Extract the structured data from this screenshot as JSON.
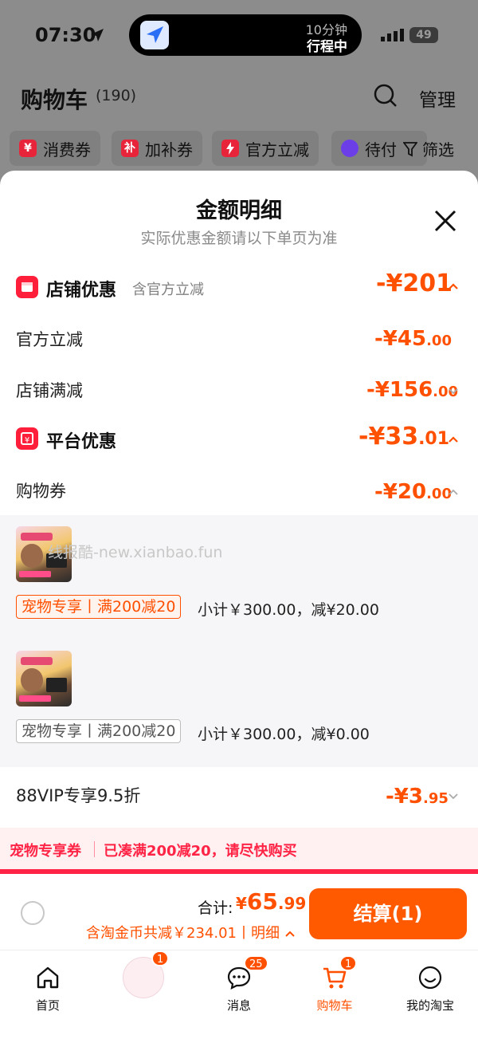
{
  "status_bar": {
    "time": "07:30",
    "island_line1": "10分钟",
    "island_line2": "行程中",
    "battery": "49"
  },
  "header": {
    "title": "购物车",
    "count": "(190)",
    "manage_label": "管理"
  },
  "chips": [
    "消费券",
    "加补券",
    "官方立减",
    "待付"
  ],
  "chip_icons": {
    "c1": "¥",
    "c2": "补"
  },
  "filter_label": "筛选",
  "sheet": {
    "title": "金额明细",
    "subtitle": "实际优惠金额请以下单页为准",
    "store": {
      "title": "店铺优惠",
      "note": "含官方立减",
      "amount": "-¥201",
      "rows": [
        {
          "label": "官方立减",
          "int": "-¥45",
          "dec": ".00"
        },
        {
          "label": "店铺满减",
          "int": "-¥156",
          "dec": ".00"
        }
      ]
    },
    "platform": {
      "title": "平台优惠",
      "amount_int": "-¥33",
      "amount_dec": ".01",
      "coupon_label": "购物券",
      "coupon_int": "-¥20",
      "coupon_dec": ".00"
    },
    "watermark": "线报酷-new.xianbao.fun",
    "coupons": [
      {
        "tag": "宠物专享丨满200减20",
        "subtotal": "小计￥300.00，减¥20.00"
      },
      {
        "tag": "宠物专享丨满200减20",
        "subtotal": "小计￥300.00，减¥0.00"
      }
    ],
    "vip": {
      "label": "88VIP专享9.5折",
      "int": "-¥3",
      "dec": ".95"
    }
  },
  "promo": {
    "tag": "宠物专享券",
    "text": "已凑满200减20，请尽快购买"
  },
  "checkout": {
    "total_label": "合计:",
    "currency": "¥",
    "total_int": "65",
    "total_dec": ".99",
    "note": "含淘金币共减￥234.01丨明细",
    "pay_label": "结算(1)"
  },
  "tabbar": [
    {
      "label": "首页"
    },
    {
      "label": "",
      "badge": "1"
    },
    {
      "label": "消息",
      "badge": "25"
    },
    {
      "label": "购物车",
      "badge": "1"
    },
    {
      "label": "我的淘宝"
    }
  ],
  "colors": {
    "accent": "#ff5000",
    "promo_red": "#ff2445",
    "icon_red": "#ff1f3a"
  }
}
